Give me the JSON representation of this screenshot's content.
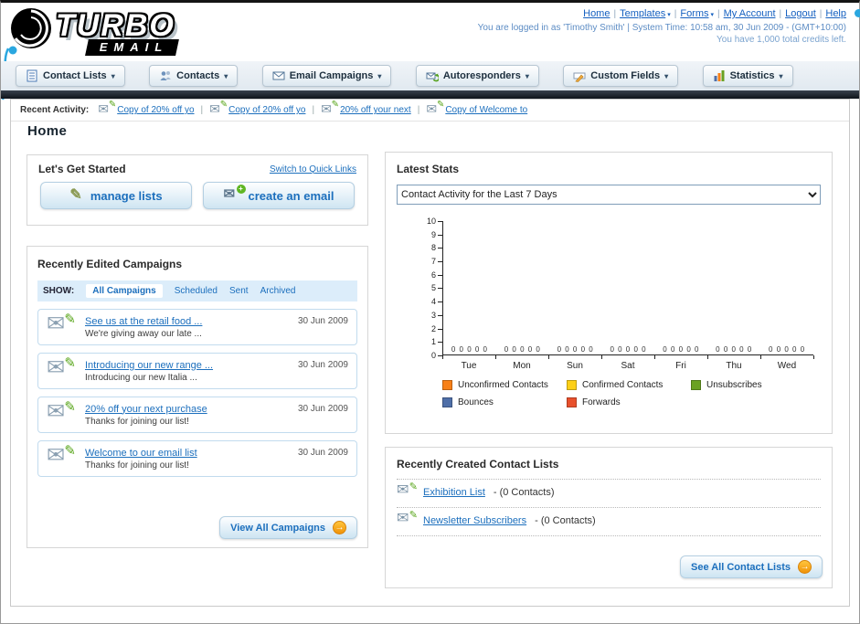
{
  "brand": {
    "name": "TURBO",
    "sub": "EMAIL"
  },
  "topnav": {
    "links": [
      {
        "label": "Home",
        "dropdown": false
      },
      {
        "label": "Templates",
        "dropdown": true
      },
      {
        "label": "Forms",
        "dropdown": true
      },
      {
        "label": "My Account",
        "dropdown": false
      },
      {
        "label": "Logout",
        "dropdown": false
      },
      {
        "label": "Help",
        "dropdown": false
      }
    ],
    "separator": "|",
    "caret": "▾",
    "login_info": "You are logged in as 'Timothy Smith' | System Time: 10:58 am, 30 Jun 2009 - (GMT+10:00)",
    "credits_info": "You have 1,000 total credits left."
  },
  "mainnav": {
    "caret": "▾",
    "tabs": [
      {
        "label": "Contact Lists",
        "icon": "contact-lists-icon"
      },
      {
        "label": "Contacts",
        "icon": "contacts-icon"
      },
      {
        "label": "Email Campaigns",
        "icon": "email-campaigns-icon"
      },
      {
        "label": "Autoresponders",
        "icon": "autoresponders-icon"
      },
      {
        "label": "Custom Fields",
        "icon": "custom-fields-icon"
      },
      {
        "label": "Statistics",
        "icon": "statistics-icon"
      }
    ]
  },
  "recent_activity": {
    "label": "Recent Activity:",
    "separator": "|",
    "items": [
      {
        "label": "Copy of 20% off yo"
      },
      {
        "label": "Copy of 20% off yo"
      },
      {
        "label": "20% off your next"
      },
      {
        "label": "Copy of Welcome to"
      }
    ]
  },
  "page": {
    "title": "Home"
  },
  "get_started": {
    "title": "Let's Get Started",
    "switch_link": "Switch to Quick Links",
    "manage_lists_label": "manage lists",
    "create_email_label": "create an email"
  },
  "campaigns": {
    "title": "Recently Edited Campaigns",
    "show_label": "SHOW:",
    "filters": [
      {
        "label": "All Campaigns",
        "active": true
      },
      {
        "label": "Scheduled",
        "active": false
      },
      {
        "label": "Sent",
        "active": false
      },
      {
        "label": "Archived",
        "active": false
      }
    ],
    "items": [
      {
        "title": "See us at the retail food ...",
        "subtitle": "We're giving away our late ...",
        "date": "30 Jun 2009"
      },
      {
        "title": "Introducing our new range ...",
        "subtitle": "Introducing our new Italia ...",
        "date": "30 Jun 2009"
      },
      {
        "title": "20% off your next purchase",
        "subtitle": "Thanks for joining our list!",
        "date": "30 Jun 2009"
      },
      {
        "title": "Welcome to our email list",
        "subtitle": "Thanks for joining our list!",
        "date": "30 Jun 2009"
      }
    ],
    "view_all_label": "View All Campaigns"
  },
  "latest_stats": {
    "title": "Latest Stats",
    "period_selected": "Contact Activity for the Last 7 Days",
    "chart_data": {
      "type": "bar",
      "title": "Contact Activity for the Last 7 Days",
      "categories": [
        "Tue",
        "Mon",
        "Sun",
        "Sat",
        "Fri",
        "Thu",
        "Wed"
      ],
      "series": [
        {
          "name": "Unconfirmed Contacts",
          "color": "#f88017",
          "values": [
            0,
            0,
            0,
            0,
            0,
            0,
            0
          ]
        },
        {
          "name": "Confirmed Contacts",
          "color": "#fdd017",
          "values": [
            0,
            0,
            0,
            0,
            0,
            0,
            0
          ]
        },
        {
          "name": "Unsubscribes",
          "color": "#6aa121",
          "values": [
            0,
            0,
            0,
            0,
            0,
            0,
            0
          ]
        },
        {
          "name": "Bounces",
          "color": "#4f6fa8",
          "values": [
            0,
            0,
            0,
            0,
            0,
            0,
            0
          ]
        },
        {
          "name": "Forwards",
          "color": "#e8502c",
          "values": [
            0,
            0,
            0,
            0,
            0,
            0,
            0
          ]
        }
      ],
      "ylim": [
        0,
        10
      ],
      "y_ticks": [
        10,
        9,
        8,
        7,
        6,
        5,
        4,
        3,
        2,
        1,
        0
      ],
      "zero_values_label": "0 0 0 0 0",
      "legend_position": "bottom",
      "grid": false
    }
  },
  "contact_lists": {
    "title": "Recently Created Contact Lists",
    "items": [
      {
        "name": "Exhibition List",
        "count": "- (0 Contacts)"
      },
      {
        "name": "Newsletter Subscribers",
        "count": "- (0 Contacts)"
      }
    ],
    "see_all_label": "See All Contact Lists"
  }
}
